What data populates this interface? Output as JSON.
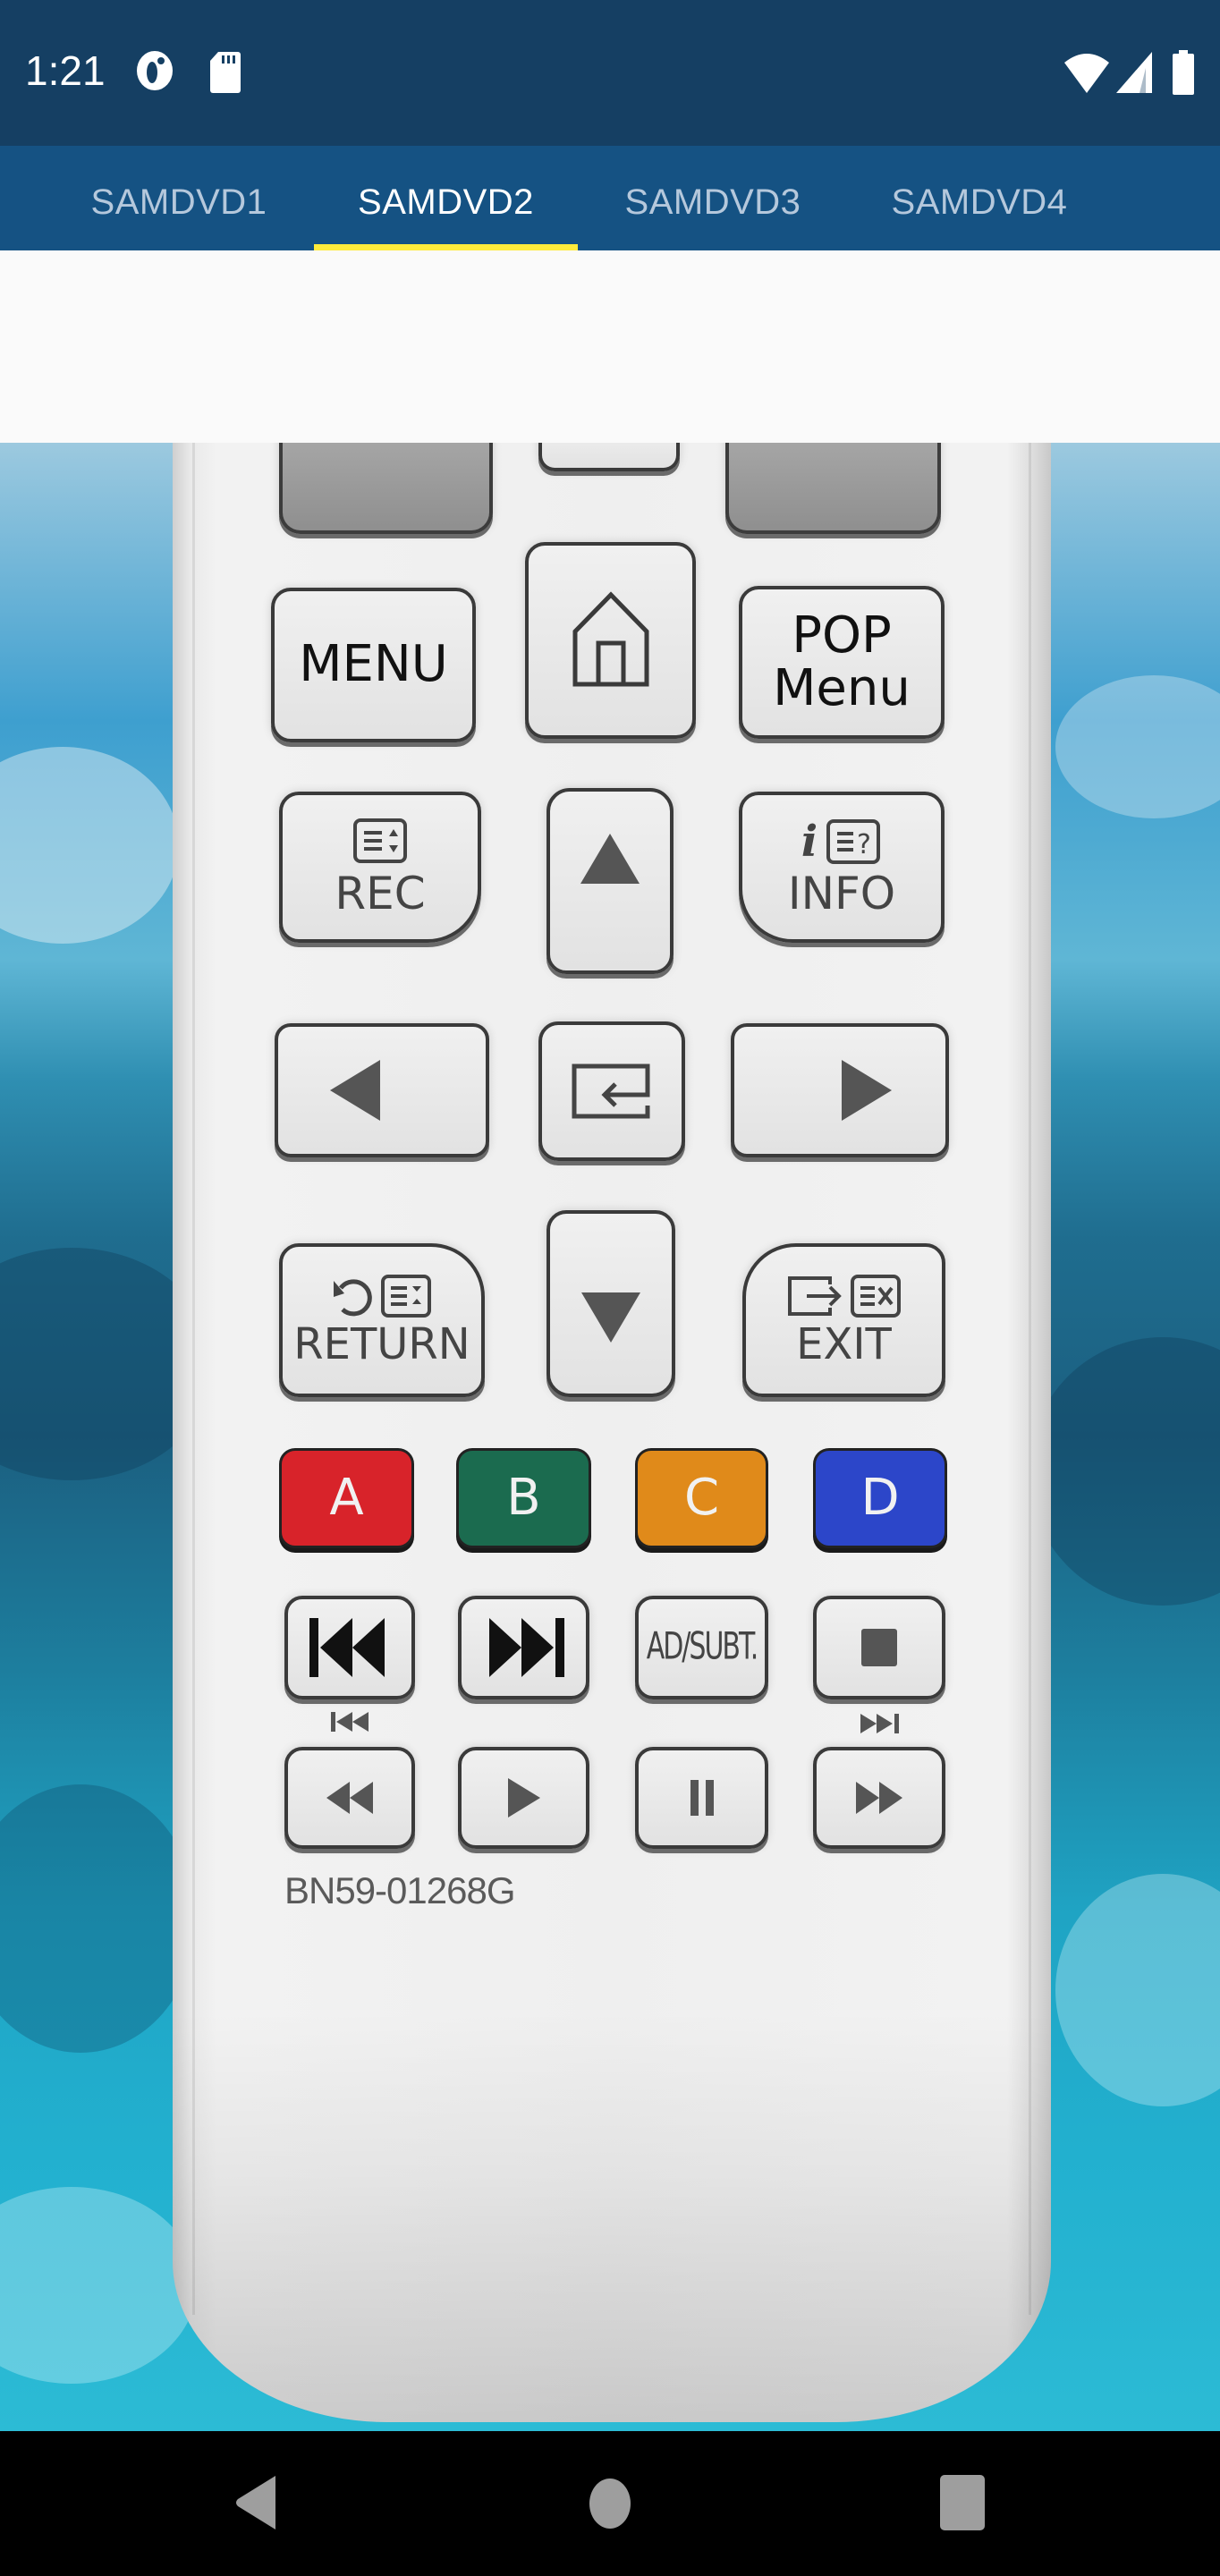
{
  "status_bar": {
    "time": "1:21",
    "left_icons": [
      "data-saver-icon",
      "sd-card-icon"
    ],
    "right_icons": [
      "wifi-icon",
      "cell-signal-icon",
      "battery-icon"
    ]
  },
  "tabs": [
    {
      "label": "SAMDVD1",
      "active": false
    },
    {
      "label": "SAMDVD2",
      "active": true
    },
    {
      "label": "SAMDVD3",
      "active": false
    },
    {
      "label": "SAMDVD4",
      "active": false
    }
  ],
  "colors": {
    "status_bar": "#153f63",
    "tab_bar": "#155283",
    "tab_indicator": "#ffeb3b",
    "button_a": "#d8232a",
    "button_b": "#1b6b4f",
    "button_c": "#e08a1a",
    "button_d": "#2c46c9"
  },
  "remote": {
    "menu_label": "MENU",
    "home_icon": "home-icon",
    "pop_menu_label": "POP\nMenu",
    "pop_line1": "POP",
    "pop_line2": "Menu",
    "rec_label": "REC",
    "info_label": "INFO",
    "info_prefix": "i",
    "return_label": "RETURN",
    "exit_label": "EXIT",
    "color_buttons": [
      "A",
      "B",
      "C",
      "D"
    ],
    "ad_subt_label": "AD/SUBT.",
    "model_number": "BN59-01268G"
  },
  "nav_bar": {
    "buttons": [
      "back",
      "home",
      "recents"
    ]
  }
}
